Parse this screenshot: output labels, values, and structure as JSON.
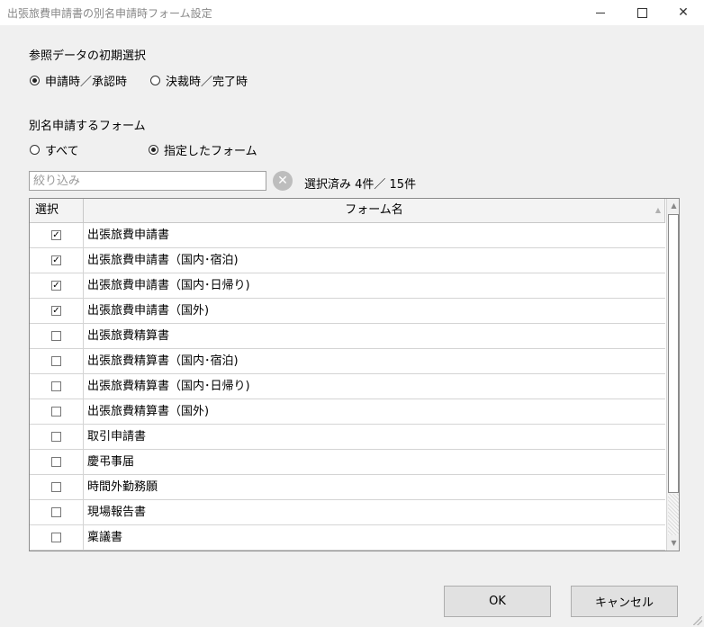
{
  "window": {
    "title": "出張旅費申請書の別名申請時フォーム設定",
    "minimize_icon": "minimize-icon",
    "maximize_icon": "maximize-icon",
    "close_glyph": "✕"
  },
  "initial_selection": {
    "label": "参照データの初期選択",
    "options": [
      {
        "label": "申請時／承認時",
        "selected": true
      },
      {
        "label": "決裁時／完了時",
        "selected": false
      }
    ]
  },
  "alias_forms": {
    "label": "別名申請するフォーム",
    "options": [
      {
        "label": "すべて",
        "selected": false
      },
      {
        "label": "指定したフォーム",
        "selected": true
      }
    ]
  },
  "filter": {
    "placeholder": "絞り込み",
    "value": "",
    "clear_glyph": "✕",
    "count_text": "選択済み 4件／ 15件"
  },
  "grid": {
    "columns": {
      "select": "選択",
      "name": "フォーム名"
    },
    "sort_glyph": "▲",
    "rows": [
      {
        "name": "出張旅費申請書",
        "checked": true
      },
      {
        "name": "出張旅費申請書（国内･宿泊)",
        "checked": true
      },
      {
        "name": "出張旅費申請書（国内･日帰り)",
        "checked": true
      },
      {
        "name": "出張旅費申請書（国外)",
        "checked": true
      },
      {
        "name": "出張旅費精算書",
        "checked": false
      },
      {
        "name": "出張旅費精算書（国内･宿泊)",
        "checked": false
      },
      {
        "name": "出張旅費精算書（国内･日帰り)",
        "checked": false
      },
      {
        "name": "出張旅費精算書（国外)",
        "checked": false
      },
      {
        "name": "取引申請書",
        "checked": false
      },
      {
        "name": "慶弔事届",
        "checked": false
      },
      {
        "name": "時間外勤務願",
        "checked": false
      },
      {
        "name": "現場報告書",
        "checked": false
      },
      {
        "name": "稟議書",
        "checked": false
      }
    ],
    "scroll_up_glyph": "▲",
    "scroll_down_glyph": "▼"
  },
  "buttons": {
    "ok": "OK",
    "cancel": "キャンセル"
  }
}
